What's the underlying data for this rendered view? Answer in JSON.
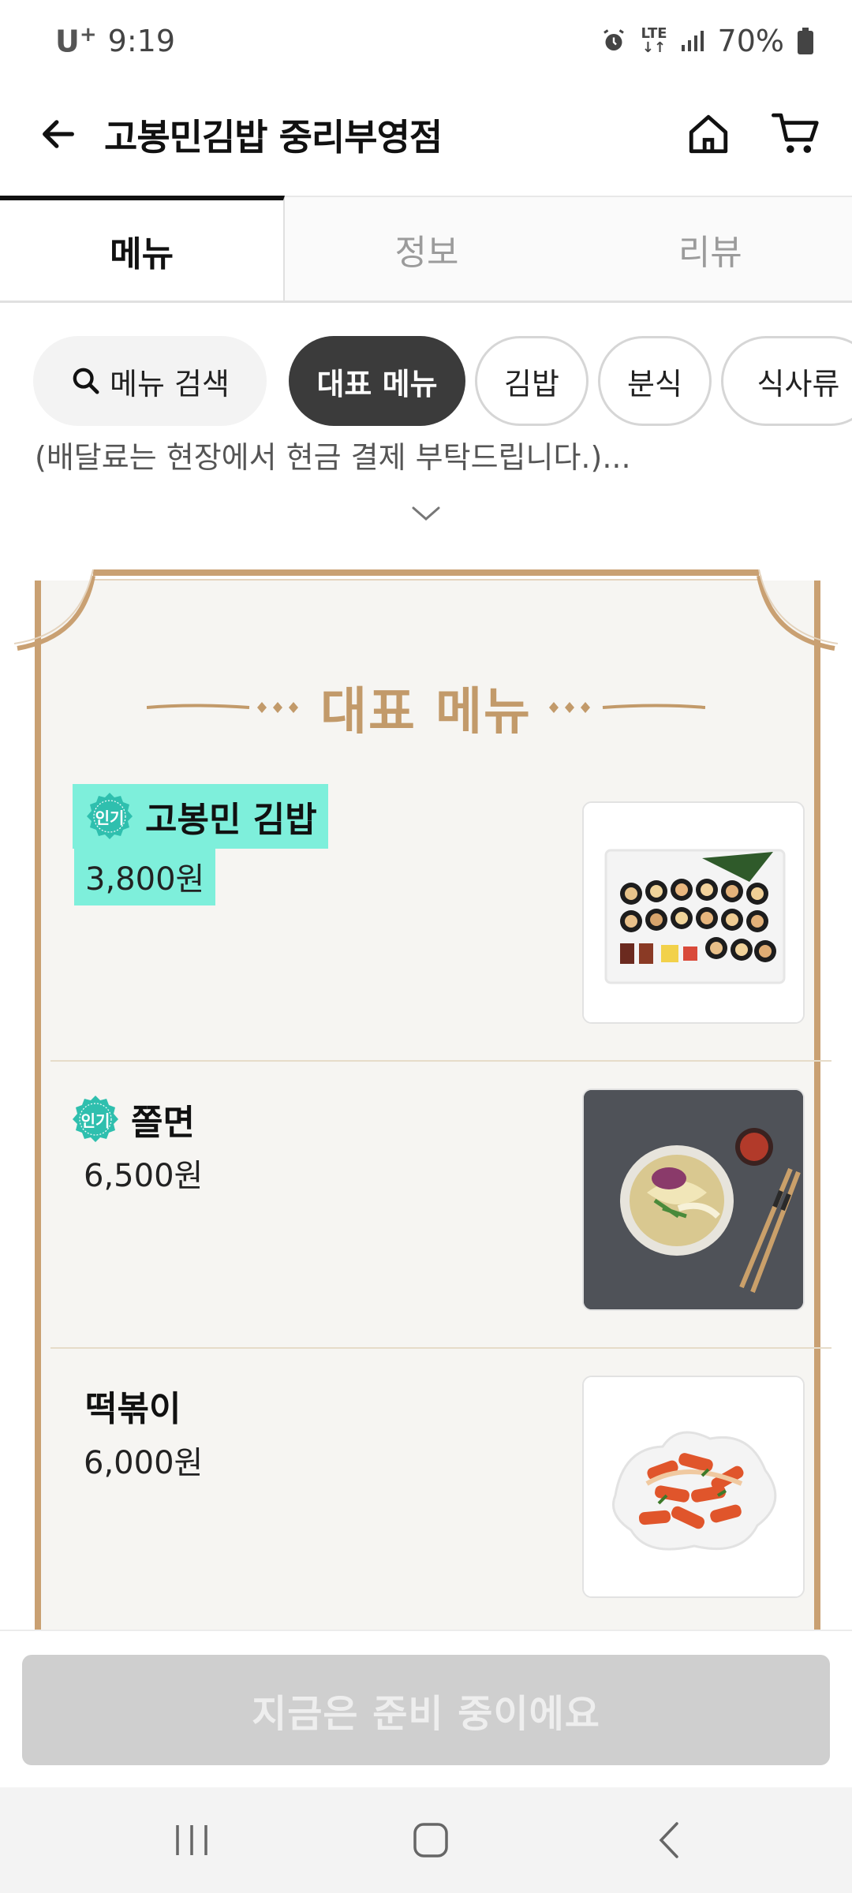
{
  "status_bar": {
    "carrier": "U",
    "carrier_sup": "+",
    "time": "9:19",
    "network": "LTE",
    "battery": "70%"
  },
  "header": {
    "title": "고봉민김밥 중리부영점"
  },
  "tabs": [
    {
      "label": "메뉴",
      "active": true
    },
    {
      "label": "정보",
      "active": false
    },
    {
      "label": "리뷰",
      "active": false
    }
  ],
  "chips": {
    "search_label": "메뉴 검색",
    "items": [
      {
        "label": "대표 메뉴",
        "active": true
      },
      {
        "label": "김밥",
        "active": false
      },
      {
        "label": "분식",
        "active": false
      },
      {
        "label": "식사류",
        "active": false
      }
    ]
  },
  "notice_truncated": "(배달료는 현장에서 현금 결제 부탁드립니다.)...",
  "board": {
    "title": "대표 메뉴"
  },
  "menu_items": [
    {
      "name": "고봉민 김밥",
      "price": "3,800원",
      "badge": "인기",
      "image_icon": "kimbap-plate-photo"
    },
    {
      "name": "쫄면",
      "price": "6,500원",
      "badge": "인기",
      "image_icon": "jjolmyeon-bowl-photo"
    },
    {
      "name": "떡볶이",
      "price": "6,000원",
      "badge": "",
      "image_icon": "tteokbokki-plate-photo"
    }
  ],
  "cta": {
    "label": "지금은 준비 중이에요"
  },
  "colors": {
    "accent_gold": "#c9a072",
    "badge_teal": "#2fbfae",
    "highlight": "#7eefdb",
    "chip_active": "#3b3b3b",
    "cta_disabled": "#cfcfcf"
  }
}
